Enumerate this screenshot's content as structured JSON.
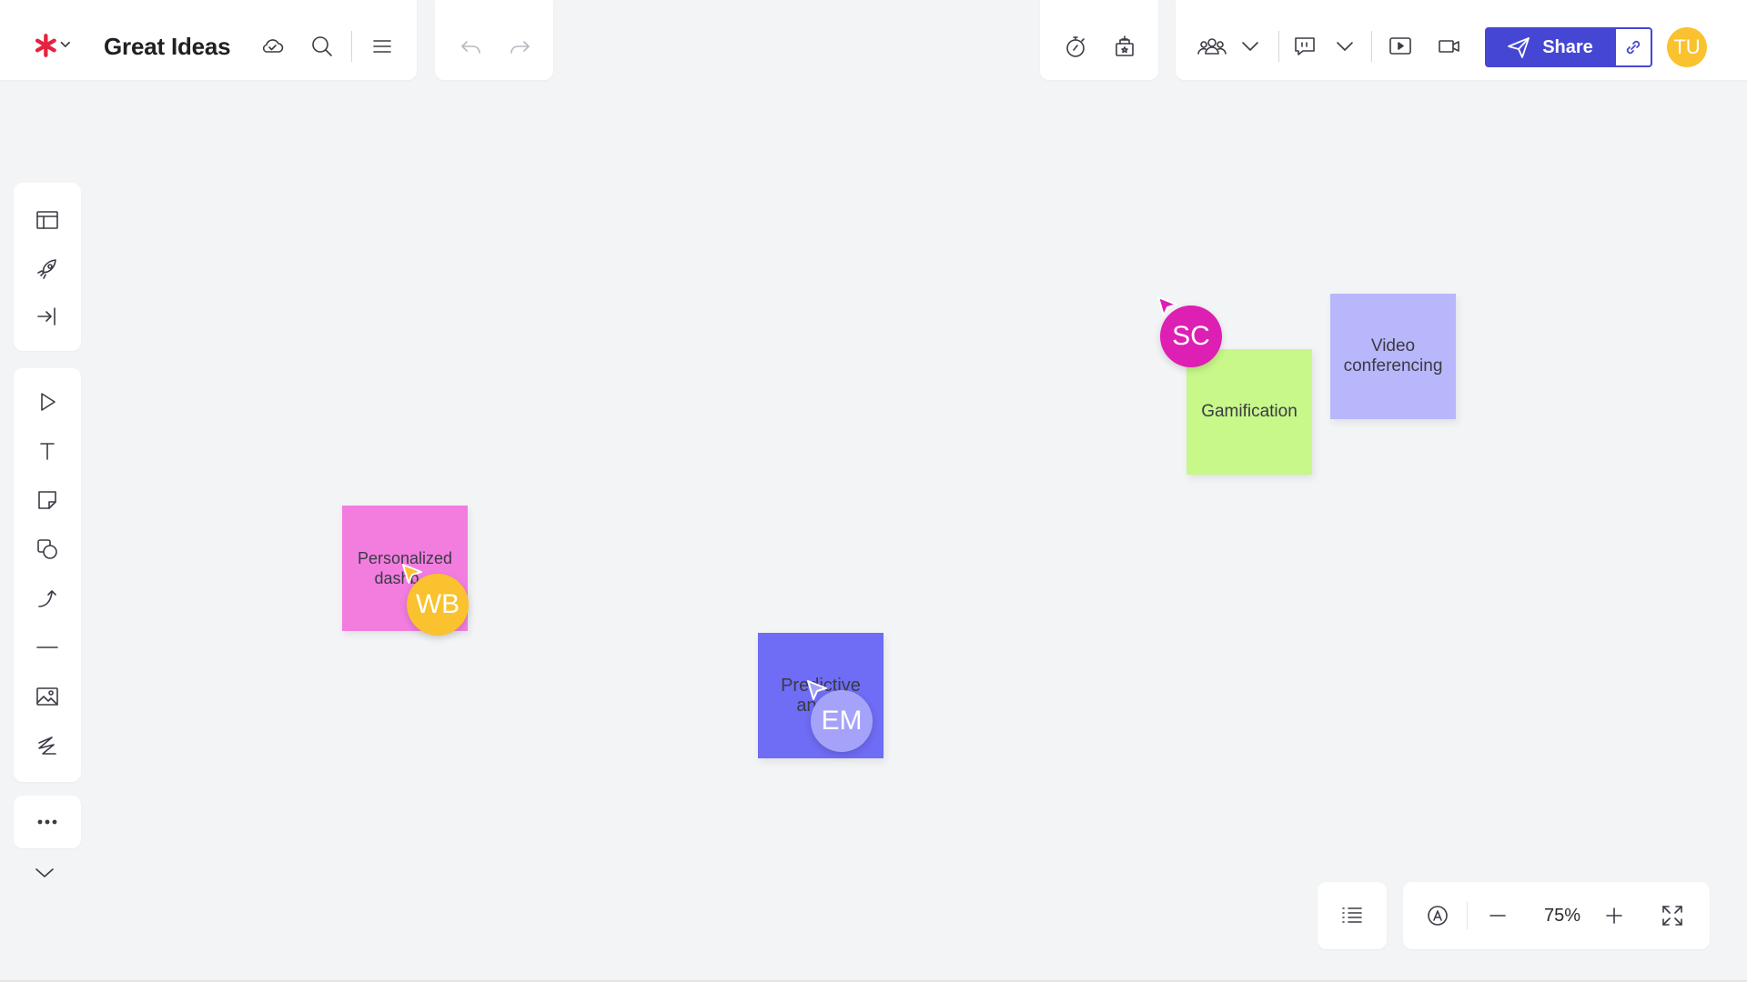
{
  "document": {
    "title": "Great Ideas"
  },
  "header": {
    "share_label": "Share",
    "user_initials": "TU"
  },
  "canvas": {
    "stickies": [
      {
        "text": "Personalized dashb…",
        "color": "#f27ddf"
      },
      {
        "text": "Predictive ana…",
        "color": "#6f6cf5"
      },
      {
        "text": "Gamification",
        "color": "#c8f78a"
      },
      {
        "text": "Video conferencing",
        "color": "#b9b7fb"
      }
    ],
    "collaborators": [
      {
        "initials": "WB",
        "color": "#f9c22e"
      },
      {
        "initials": "EM",
        "color": "#a5a3f9"
      },
      {
        "initials": "SC",
        "color": "#dd1fb3"
      }
    ]
  },
  "footer": {
    "zoom": "75%"
  },
  "colors": {
    "accent": "#4646d4",
    "canvas": "#f3f4f6"
  }
}
